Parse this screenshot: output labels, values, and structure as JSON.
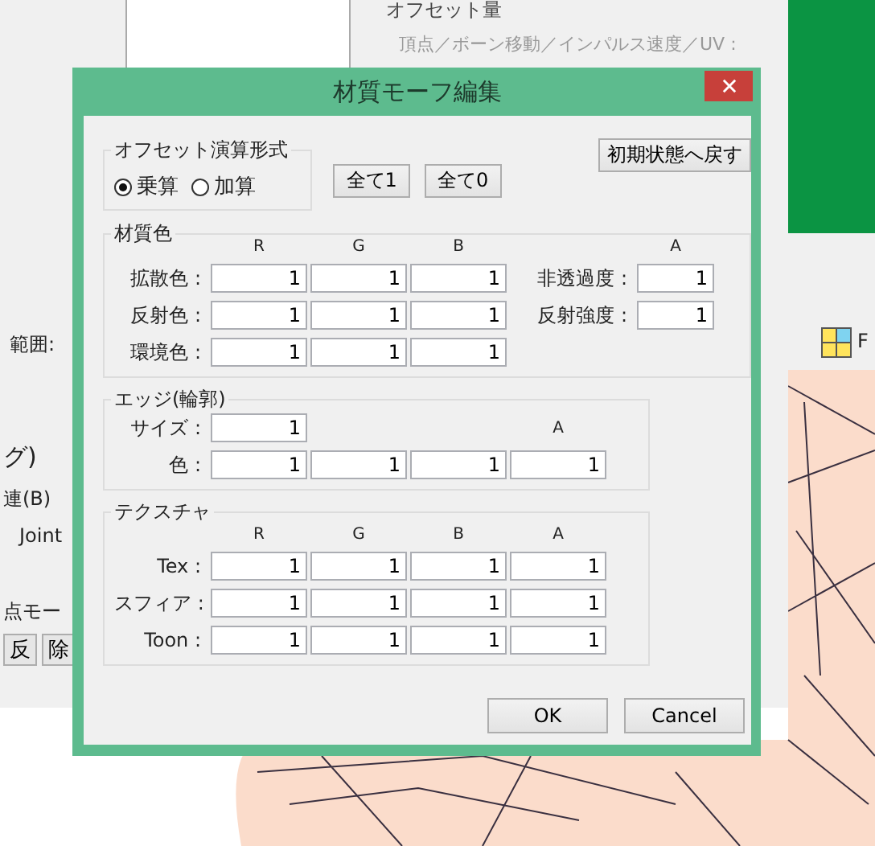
{
  "background": {
    "offset_group_label": "オフセット量",
    "offset_hint": "頂点／ボーン移動／インパルス速度／UV :",
    "left_texts": [
      "範囲:",
      "グ)",
      "連(B)",
      "Joint",
      "点モー"
    ],
    "left_buttons": [
      "反",
      "除"
    ],
    "toolbar_text": "F"
  },
  "dialog": {
    "title": "材質モーフ編集"
  },
  "offset_mode": {
    "label": "オフセット演算形式",
    "options": [
      {
        "label": "乗算",
        "selected": true
      },
      {
        "label": "加算",
        "selected": false
      }
    ]
  },
  "fill_buttons": [
    "全て1",
    "全て0"
  ],
  "reset_button": "初期状態へ戻す",
  "material_color": {
    "label": "材質色",
    "columns": [
      "R",
      "G",
      "B"
    ],
    "alpha_column": "A",
    "rows": [
      {
        "label": "拡散色 :",
        "values": [
          "1",
          "1",
          "1"
        ],
        "extra": {
          "label": "非透過度 :",
          "value": "1"
        }
      },
      {
        "label": "反射色 :",
        "values": [
          "1",
          "1",
          "1"
        ],
        "extra": {
          "label": "反射強度 :",
          "value": "1"
        }
      },
      {
        "label": "環境色 :",
        "values": [
          "1",
          "1",
          "1"
        ]
      }
    ]
  },
  "edge": {
    "label": "エッジ(輪郭)",
    "size_label": "サイズ :",
    "size": "1",
    "alpha_column": "A",
    "color_label": "色 :",
    "color_values": [
      "1",
      "1",
      "1",
      "1"
    ]
  },
  "texture": {
    "label": "テクスチャ",
    "columns": [
      "R",
      "G",
      "B",
      "A"
    ],
    "rows": [
      {
        "label": "Tex :",
        "values": [
          "1",
          "1",
          "1",
          "1"
        ]
      },
      {
        "label": "スフィア :",
        "values": [
          "1",
          "1",
          "1",
          "1"
        ]
      },
      {
        "label": "Toon :",
        "values": [
          "1",
          "1",
          "1",
          "1"
        ]
      }
    ]
  },
  "footer_buttons": [
    "OK",
    "Cancel"
  ]
}
